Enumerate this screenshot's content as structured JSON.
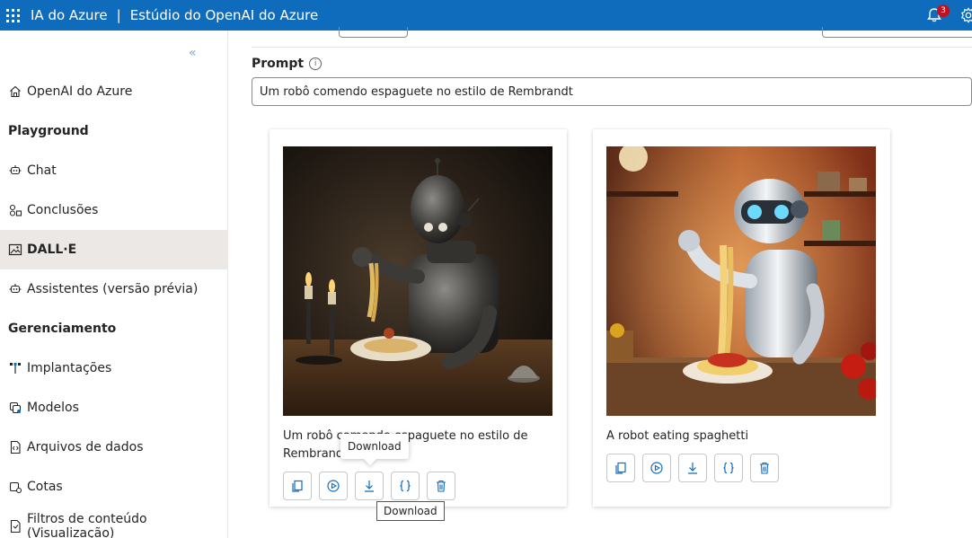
{
  "header": {
    "product": "IA do Azure",
    "separator": "|",
    "studio": "Estúdio do OpenAI do Azure",
    "notifications_count": "3"
  },
  "sidebar": {
    "items": [
      {
        "label": "OpenAI do Azure",
        "icon": "home-icon"
      },
      {
        "heading": "Playground"
      },
      {
        "label": "Chat",
        "icon": "chat-icon"
      },
      {
        "label": "Conclusões",
        "icon": "completions-icon"
      },
      {
        "label": "DALL·E",
        "icon": "image-icon",
        "active": true
      },
      {
        "label": "Assistentes (versão prévia)",
        "icon": "assistant-icon"
      },
      {
        "heading": "Gerenciamento"
      },
      {
        "label": "Implantações",
        "icon": "deployments-icon"
      },
      {
        "label": "Modelos",
        "icon": "models-icon"
      },
      {
        "label": "Arquivos de dados",
        "icon": "data-files-icon"
      },
      {
        "label": "Cotas",
        "icon": "quota-icon"
      },
      {
        "label": "Filtros de conteúdo (Visualização)",
        "icon": "content-filter-icon"
      }
    ]
  },
  "main": {
    "prompt_label": "Prompt",
    "prompt_value": "Um robô comendo espaguete no estilo de Rembrandt",
    "cards": [
      {
        "caption": "Um robô comendo espaguete no estilo de Rembrandt"
      },
      {
        "caption": "A robot eating spaghetti"
      }
    ],
    "tooltip_hover": "Download",
    "tooltip_title": "Download"
  },
  "colors": {
    "brand": "#0f6cbd",
    "active_nav": "#ebe8e6",
    "badge": "#c50f1f"
  }
}
